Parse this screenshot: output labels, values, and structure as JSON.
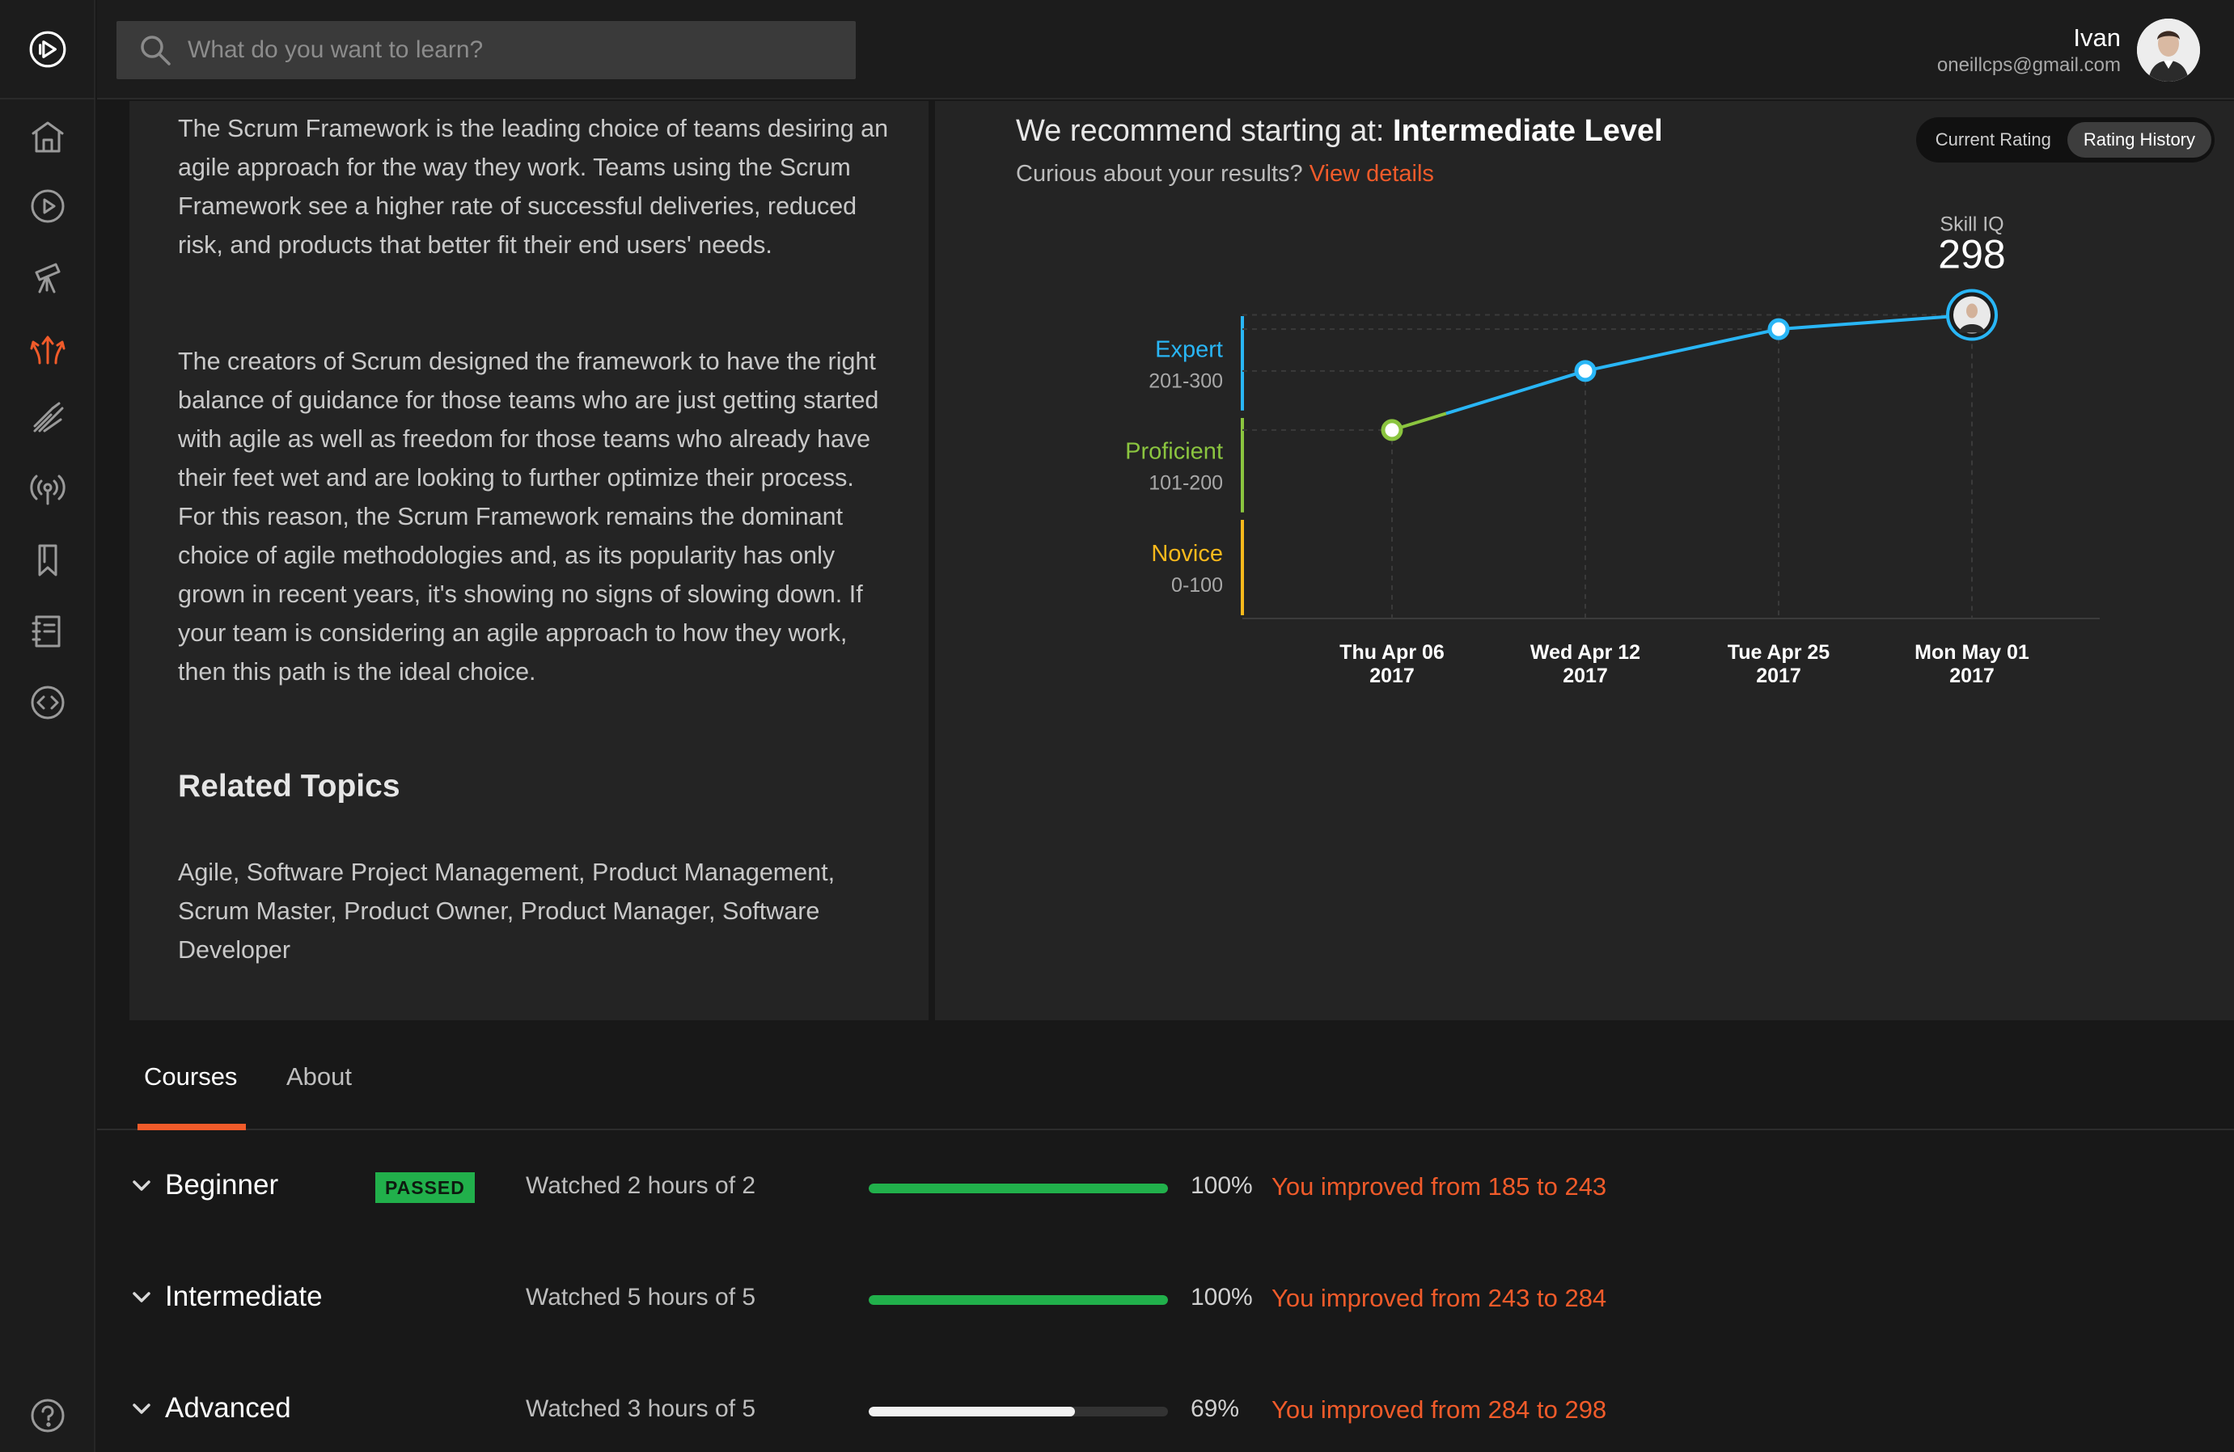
{
  "search": {
    "placeholder": "What do you want to learn?"
  },
  "user": {
    "name": "Ivan",
    "email": "oneillcps@gmail.com"
  },
  "nav": {
    "items": [
      {
        "icon": "home-icon"
      },
      {
        "icon": "play-circle-icon"
      },
      {
        "icon": "telescope-icon"
      },
      {
        "icon": "paths-icon",
        "active": true
      },
      {
        "icon": "skills-icon"
      },
      {
        "icon": "broadcast-icon"
      },
      {
        "icon": "bookmark-icon"
      },
      {
        "icon": "notebook-icon"
      },
      {
        "icon": "code-icon"
      }
    ],
    "help_icon": "help-icon"
  },
  "description": {
    "paragraph1": "The Scrum Framework is the leading choice of teams desiring an agile approach for the way they work. Teams using the Scrum Framework see a higher rate of successful deliveries, reduced risk, and products that better fit their end users' needs.",
    "paragraph2": "The creators of Scrum designed the framework to have the right balance of guidance for those teams who are just getting started with agile as well as freedom for those teams who already have their feet wet and are looking to further optimize their process. For this reason, the Scrum Framework remains the dominant choice of agile methodologies and, as its popularity has only grown in recent years, it's showing no signs of slowing down. If your team is considering an agile approach to how they work, then this path is the ideal choice.",
    "related_title": "Related Topics",
    "related_list": "Agile, Software Project Management, Product Management, Scrum Master, Product Owner, Product Manager, Software Developer"
  },
  "recommendation": {
    "prefix": "We recommend starting at: ",
    "level": "Intermediate Level",
    "curious": "Curious about your results? ",
    "details_link": "View details"
  },
  "rating_toggle": {
    "current": "Current Rating",
    "history": "Rating History",
    "selected": "Rating History"
  },
  "chart_data": {
    "type": "line",
    "skill_label": "Skill IQ",
    "skill_value": "298",
    "bands": [
      {
        "name": "Expert",
        "range": "201-300",
        "min": 201,
        "max": 300,
        "color": "#29b6f6"
      },
      {
        "name": "Proficient",
        "range": "101-200",
        "min": 101,
        "max": 200,
        "color": "#8bc53f"
      },
      {
        "name": "Novice",
        "range": "0-100",
        "min": 0,
        "max": 100,
        "color": "#f9b91c"
      }
    ],
    "points": [
      {
        "day": "Thu Apr 06",
        "year": "2017",
        "value": 185
      },
      {
        "day": "Wed Apr 12",
        "year": "2017",
        "value": 243
      },
      {
        "day": "Tue Apr 25",
        "year": "2017",
        "value": 284
      },
      {
        "day": "Mon May 01",
        "year": "2017",
        "value": 298
      }
    ],
    "ylim": [
      0,
      300
    ]
  },
  "tabs": {
    "courses": "Courses",
    "about": "About",
    "selected": "Courses"
  },
  "courses": [
    {
      "name": "Beginner",
      "badge": "PASSED",
      "watched": "Watched 2 hours of 2",
      "progress": 100,
      "pct": "100%",
      "improved": "You improved from 185 to 243",
      "bar_color": "#21b04b"
    },
    {
      "name": "Intermediate",
      "badge": "",
      "watched": "Watched 5 hours of 5",
      "progress": 100,
      "pct": "100%",
      "improved": "You improved from 243 to 284",
      "bar_color": "#21b04b"
    },
    {
      "name": "Advanced",
      "badge": "",
      "watched": "Watched 3 hours of 5",
      "progress": 69,
      "pct": "69%",
      "improved": "You improved from 284 to 298",
      "bar_color": "#f2f2f2"
    }
  ]
}
